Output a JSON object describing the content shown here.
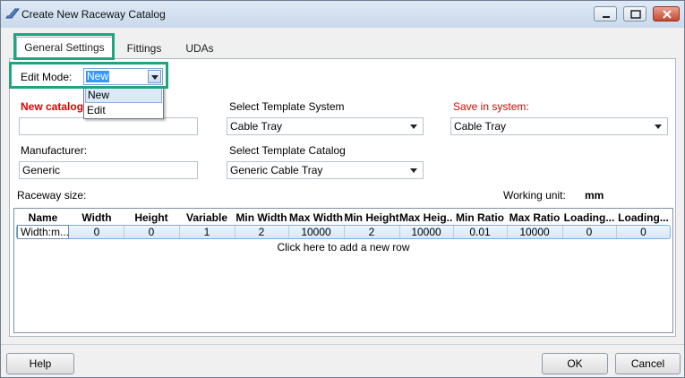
{
  "window": {
    "title": "Create New Raceway Catalog"
  },
  "tabs": [
    {
      "label": "General Settings"
    },
    {
      "label": "Fittings"
    },
    {
      "label": "UDAs"
    }
  ],
  "edit_mode": {
    "label": "Edit Mode:",
    "value": "New",
    "options": [
      "New",
      "Edit"
    ]
  },
  "form": {
    "new_catalog_label": "New catalog",
    "new_catalog_value": "",
    "manufacturer_label": "Manufacturer:",
    "manufacturer_value": "Generic",
    "template_system_label": "Select Template System",
    "template_system_value": "Cable Tray",
    "template_catalog_label": "Select Template Catalog",
    "template_catalog_value": "Generic Cable Tray",
    "save_in_label": "Save in system:",
    "save_in_value": "Cable Tray",
    "raceway_size_label": "Raceway size:",
    "working_unit_label": "Working unit:",
    "working_unit_value": "mm"
  },
  "grid": {
    "columns": [
      "Name",
      "Width",
      "Height",
      "Variable",
      "Min Width",
      "Max Width",
      "Min Height",
      "Max Heig...",
      "Min Ratio",
      "Max Ratio",
      "Loading...",
      "Loading..."
    ],
    "rows": [
      [
        "Width:m...",
        "0",
        "0",
        "1",
        "2",
        "10000",
        "2",
        "10000",
        "0.01",
        "10000",
        "0",
        "0"
      ]
    ],
    "add_row_text": "Click here to add a new row"
  },
  "buttons": {
    "help": "Help",
    "ok": "OK",
    "cancel": "Cancel"
  },
  "colors": {
    "highlight": "#1da67e",
    "required_label": "#e00000",
    "selection": "#3399ff"
  }
}
